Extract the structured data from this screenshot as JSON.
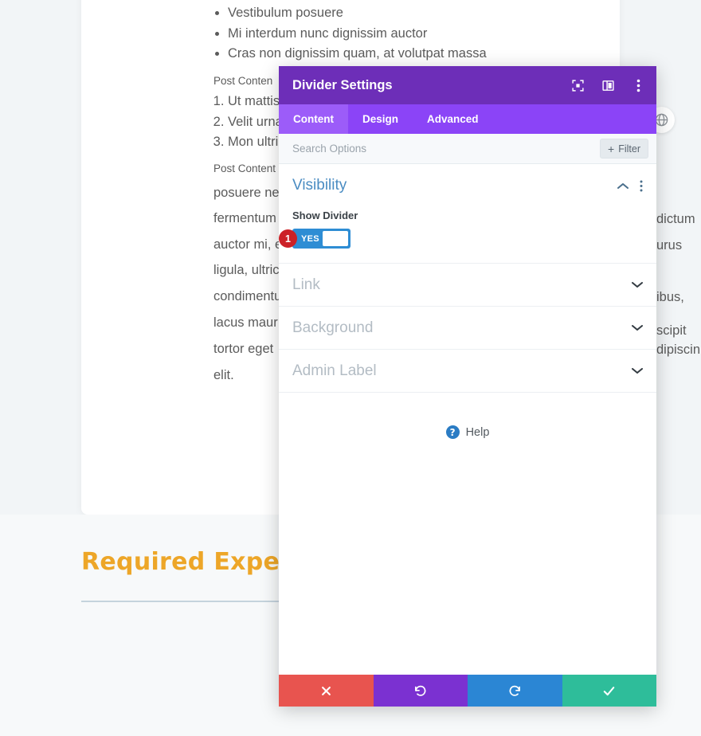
{
  "background_page": {
    "bullet_list": [
      "Vestibulum posuere",
      "Mi interdum nunc dignissim auctor",
      "Cras non dignissim quam, at volutpat massa"
    ],
    "label_1": "Post Conten",
    "numbered_list": [
      "Ut mattis",
      "Velit urna",
      "Mon ultri"
    ],
    "label_2": "Post Content H",
    "paragraph_lines": [
      "posuere ne",
      "fermentum",
      "auctor mi, e",
      "ligula, ultric",
      "condimentu",
      "lacus maur",
      "tortor eget",
      "elit."
    ],
    "right_fragments": [
      "dictum",
      "urus",
      "ibus,",
      "scipit",
      "dipiscin"
    ],
    "globe_icon": "globe-icon",
    "section_heading": "Required Experience"
  },
  "modal": {
    "title": "Divider Settings",
    "header_icons": [
      {
        "name": "focus-icon"
      },
      {
        "name": "panel-layout-icon"
      },
      {
        "name": "more-options-icon"
      }
    ],
    "tabs": [
      {
        "label": "Content",
        "active": true
      },
      {
        "label": "Design",
        "active": false
      },
      {
        "label": "Advanced",
        "active": false
      }
    ],
    "search": {
      "placeholder": "Search Options",
      "value": ""
    },
    "filter_button": {
      "label": "Filter",
      "plus": "+"
    },
    "sections": [
      {
        "title": "Visibility",
        "state": "open",
        "collapse_icon": "chevron-up-icon",
        "menu_icon": "more-options-icon"
      },
      {
        "title": "Link",
        "state": "closed",
        "expand_icon": "chevron-down-icon"
      },
      {
        "title": "Background",
        "state": "closed",
        "expand_icon": "chevron-down-icon"
      },
      {
        "title": "Admin Label",
        "state": "closed",
        "expand_icon": "chevron-down-icon"
      }
    ],
    "show_divider": {
      "label": "Show Divider",
      "toggle_value": "YES",
      "annotation_number": "1"
    },
    "help": {
      "label": "Help",
      "icon_glyph": "?"
    },
    "actions": [
      {
        "name": "cancel-button",
        "glyph": "✖",
        "color": "#e8544f"
      },
      {
        "name": "undo-button",
        "glyph": "↺",
        "color": "#7b31d1"
      },
      {
        "name": "redo-button",
        "glyph": "↻",
        "color": "#2b86d4"
      },
      {
        "name": "save-button",
        "glyph": "✔",
        "color": "#2ebd9a"
      }
    ]
  },
  "colors": {
    "header_purple": "#6d2eb8",
    "tab_purple": "#8b44f7",
    "tab_active_purple": "#9c5cf9",
    "toggle_blue": "#2e8dd4",
    "badge_red": "#cc2127",
    "heading_orange": "#eda628",
    "section_title_blue": "#4a8cc2"
  }
}
